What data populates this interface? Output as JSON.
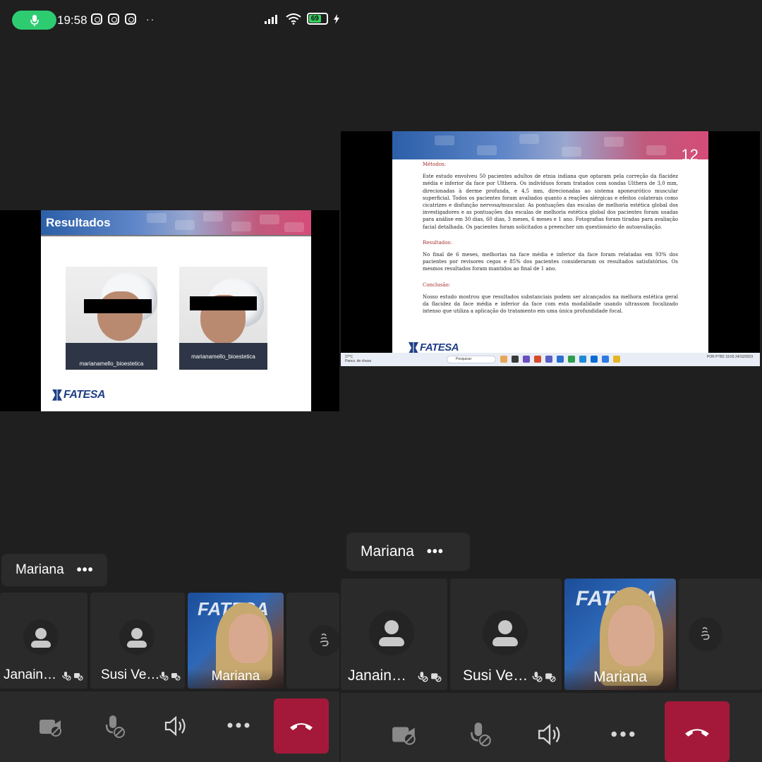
{
  "status_bar": {
    "time": "19:58",
    "battery": "69"
  },
  "left_call": {
    "slide": {
      "title": "Resultados",
      "photo_credits": [
        "marianamello_bioestetica",
        "marianamello_bioestetica"
      ],
      "logo": "FATESA"
    },
    "presenter_chip": {
      "name": "Mariana",
      "more": "•••"
    },
    "participants": [
      {
        "name": "Janain…",
        "type": "avatar"
      },
      {
        "name": "Susi Ve…",
        "type": "avatar"
      },
      {
        "name": "Mariana",
        "type": "video"
      }
    ],
    "controls": [
      "camera-off",
      "mic-off",
      "speaker",
      "more",
      "hang-up"
    ]
  },
  "right_call": {
    "slide": {
      "slide_number": "12",
      "heading_methods": "Métodos:",
      "methods_text": "Este estudo envolveu 50 pacientes adultos de etnia indiana que optaram pela correção da flacidez média e inferior da face por Ulthera. Os indivíduos foram tratados com sondas Ulthera de 3,0 mm, direcionadas à derme profunda, e 4,5 mm, direcionadas ao sistema aponeurótico muscular superficial. Todos os pacientes foram avaliados quanto a reações alérgicas e efeitos colaterais como cicatrizes e disfunção nervosa/muscular. As pontuações das escalas de melhoria estética global dos investigadores e as pontuações das escalas de melhoria estética global dos pacientes foram usadas para análise em 30 dias, 60 dias, 3 meses, 6 meses e 1 ano. Fotografias foram tiradas para avaliação facial detalhada. Os pacientes foram solicitados a preencher um questionário de autoavaliação.",
      "heading_results": "Resultados:",
      "results_text": "No final de 6 meses, melhorias na face média e inferior da face foram relatadas em 93% dos pacientes por revisores cegos e 85% dos pacientes consideraram os resultados satisfatórios. Os mesmos resultados foram mantidos ao final de 1 ano.",
      "heading_conclusion": "Conclusão:",
      "conclusion_text": "Nosso estudo mostrou que resultados substanciais podem ser alcançados na melhora estética geral da flacidez da face média e inferior da face com esta modalidade usando ultrassom focalizado intenso que utiliza a aplicação do tratamento em uma única profundidade focal.",
      "logo": "FATESA",
      "taskbar": {
        "weather_temp": "27°C",
        "weather_desc": "Pancs. de chuva",
        "search_placeholder": "Pesquisar",
        "language": "POR PTB2",
        "time": "19:03",
        "date": "24/10/2023"
      }
    },
    "presenter_chip": {
      "name": "Mariana",
      "more": "•••"
    },
    "participants": [
      {
        "name": "Janain…",
        "type": "avatar"
      },
      {
        "name": "Susi Ve…",
        "type": "avatar"
      },
      {
        "name": "Mariana",
        "type": "video"
      }
    ],
    "controls": [
      "camera-off",
      "mic-off",
      "speaker",
      "more",
      "hang-up"
    ]
  },
  "colors": {
    "hangup": "#a4193a",
    "background": "#1f1f1f",
    "mic_pill": "#2ecc71",
    "battery": "#35d15f",
    "slide_heading": "#a3302e"
  }
}
